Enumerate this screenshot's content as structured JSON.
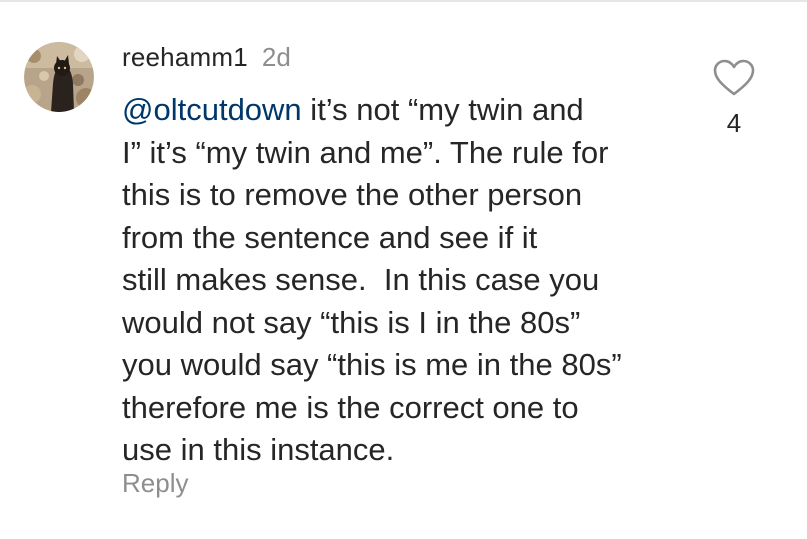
{
  "comment": {
    "username": "reehamm1",
    "timestamp": "2d",
    "mention": "@oltcutdown",
    "first_line_rest": " it’s not “my twin and",
    "lines": [
      "I” it’s “my twin and me”. The rule for",
      "this is to remove the other person",
      "from the sentence and see if it",
      "still makes sense.  In this case you",
      "would not say “this is I in the 80s”",
      "you would say “this is me in the 80s”",
      "therefore me is the correct one to",
      "use in this instance."
    ],
    "like_count": "4",
    "reply_label": "Reply"
  },
  "icons": {
    "like": "heart-outline-icon",
    "avatar": "user-avatar-image"
  },
  "colors": {
    "text": "#262626",
    "secondary_text": "#8e8e8e",
    "mention": "#00376b"
  }
}
